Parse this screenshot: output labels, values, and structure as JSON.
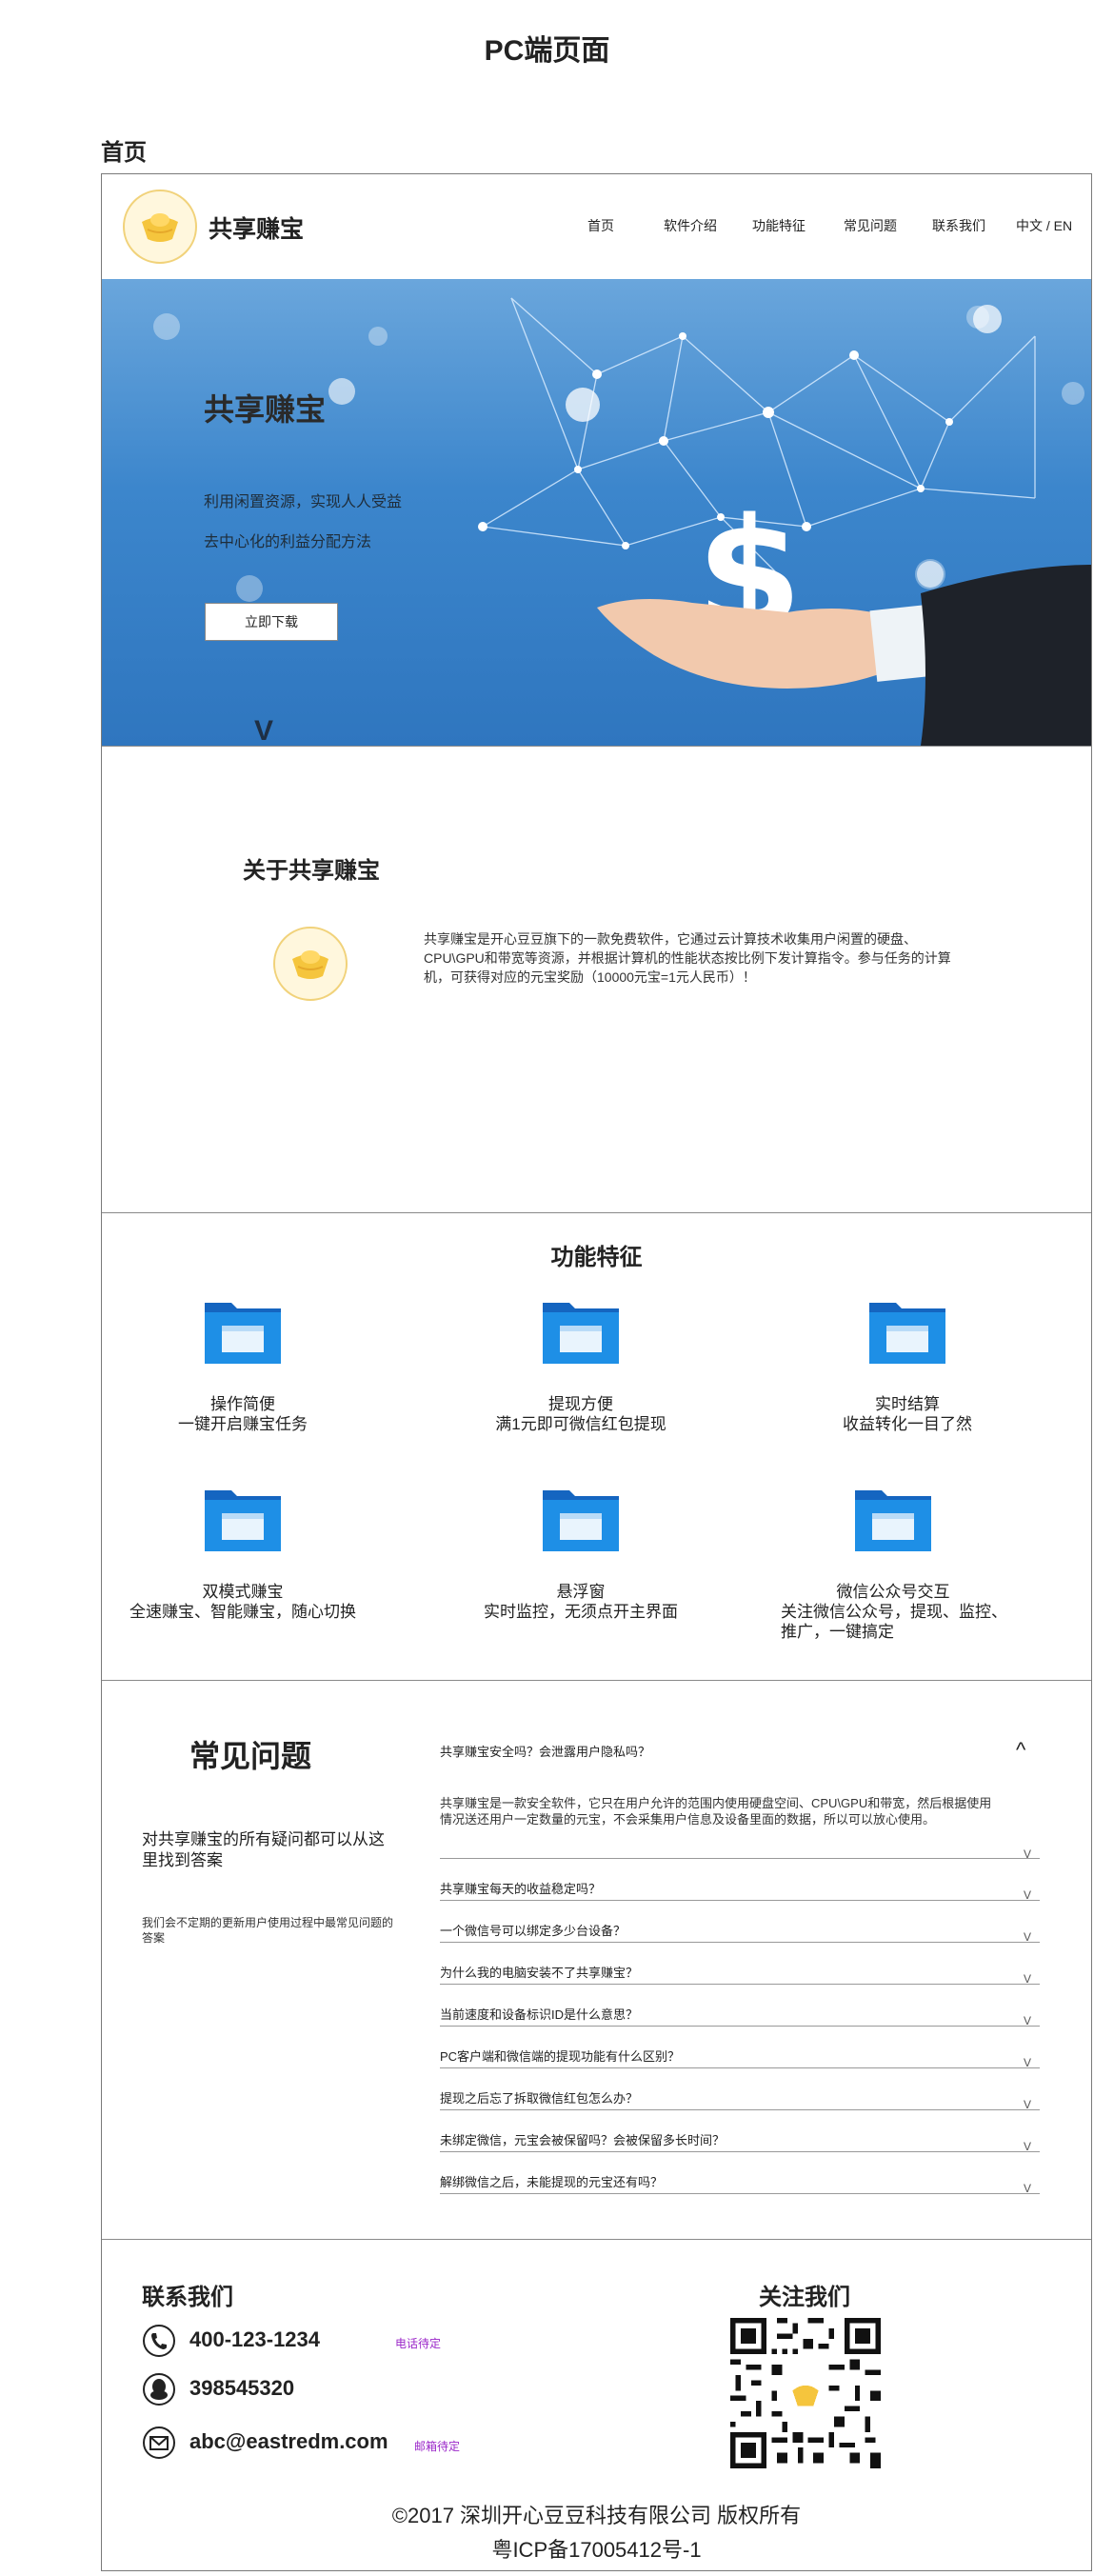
{
  "doc_title": "PC端页面",
  "section_tag": "首页",
  "header": {
    "brand": "共享赚宝",
    "nav": [
      "首页",
      "软件介绍",
      "功能特征",
      "常见问题",
      "联系我们",
      "中文 / EN"
    ]
  },
  "banner": {
    "title": "共享赚宝",
    "line1": "利用闲置资源，实现人人受益",
    "line2": "去中心化的利益分配方法",
    "button": "立即下载",
    "arrow": "V"
  },
  "about": {
    "title": "关于共享赚宝",
    "text": "共享赚宝是开心豆豆旗下的一款免费软件，它通过云计算技术收集用户闲置的硬盘、CPU\\GPU和带宽等资源，并根据计算机的性能状态按比例下发计算指令。参与任务的计算机，可获得对应的元宝奖励（10000元宝=1元人民币）！"
  },
  "features": {
    "title": "功能特征",
    "items": [
      {
        "title": "操作简便",
        "desc": "一键开启赚宝任务"
      },
      {
        "title": "提现方便",
        "desc": "满1元即可微信红包提现"
      },
      {
        "title": "实时结算",
        "desc": "收益转化一目了然"
      },
      {
        "title": "双模式赚宝",
        "desc": "全速赚宝、智能赚宝，随心切换"
      },
      {
        "title": "悬浮窗",
        "desc": "实时监控，无须点开主界面"
      },
      {
        "title": "微信公众号交互",
        "desc": "关注微信公众号，提现、监控、推广，一键搞定"
      }
    ]
  },
  "faq": {
    "title": "常见问题",
    "subtitle": "对共享赚宝的所有疑问都可以从这里找到答案",
    "note": "我们会不定期的更新用户使用过程中最常见问题的答案",
    "expanded_question": "共享赚宝安全吗？会泄露用户隐私吗？",
    "expanded_answer": "共享赚宝是一款安全软件，它只在用户允许的范围内使用硬盘空间、CPU\\GPU和带宽，然后根据使用情况送还用户一定数量的元宝，不会采集用户信息及设备里面的数据，所以可以放心使用。",
    "collapse_icon": "^",
    "expand_icon": "V",
    "questions": [
      "共享赚宝每天的收益稳定吗？",
      "一个微信号可以绑定多少台设备？",
      "为什么我的电脑安装不了共享赚宝？",
      "当前速度和设备标识ID是什么意思？",
      "PC客户端和微信端的提现功能有什么区别？",
      "提现之后忘了拆取微信红包怎么办？",
      "未绑定微信，元宝会被保留吗？会被保留多长时间？",
      "解绑微信之后，未能提现的元宝还有吗？"
    ]
  },
  "contact": {
    "title": "联系我们",
    "phone": "400-123-1234",
    "phone_note": "电话待定",
    "qq": "398545320",
    "email": "abc@eastredm.com",
    "email_note": "邮箱待定",
    "follow_title": "关注我们",
    "copyright": "©2017 深圳开心豆豆科技有限公司 版权所有",
    "icp": "粤ICP备17005412号-1"
  },
  "colors": {
    "folder_blue": "#1e8fe6",
    "banner_blue": "#3c86cc",
    "note_purple": "#9b27c9",
    "gold": "#f5c53d"
  }
}
